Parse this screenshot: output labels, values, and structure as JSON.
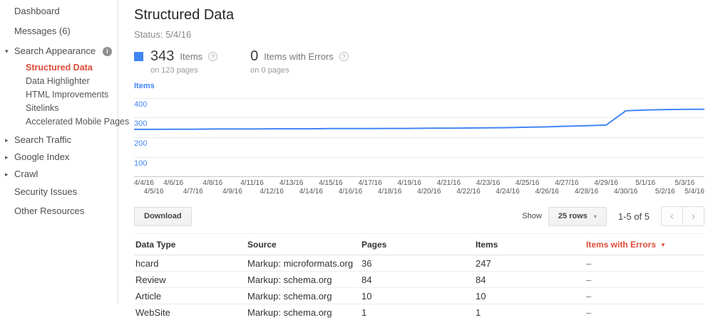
{
  "colors": {
    "accent_blue": "#4285f4",
    "alert_red": "#dd4b39"
  },
  "sidebar": {
    "items": [
      {
        "label": "Dashboard"
      },
      {
        "label": "Messages (6)"
      },
      {
        "label": "Search Appearance",
        "expanded": true,
        "has_info_icon": true
      },
      {
        "label": "Structured Data",
        "selected": true
      },
      {
        "label": "Data Highlighter"
      },
      {
        "label": "HTML Improvements"
      },
      {
        "label": "Sitelinks"
      },
      {
        "label": "Accelerated Mobile Pages"
      },
      {
        "label": "Search Traffic",
        "collapsed": true
      },
      {
        "label": "Google Index",
        "collapsed": true
      },
      {
        "label": "Crawl",
        "collapsed": true
      },
      {
        "label": "Security Issues"
      },
      {
        "label": "Other Resources"
      }
    ]
  },
  "header": {
    "title": "Structured Data",
    "status": "Status: 5/4/16"
  },
  "summary": {
    "items": {
      "count": "343",
      "label": "Items",
      "sub": "on 123 pages"
    },
    "errors": {
      "count": "0",
      "label": "Items with Errors",
      "sub": "on 0 pages"
    }
  },
  "chart_data": {
    "type": "line",
    "title": "Items",
    "ylabel": "Items",
    "xlabel": "",
    "grid": "horizontal",
    "legend_position": "none",
    "line_color": "#4285f4",
    "ylim": [
      0,
      425
    ],
    "yticks": [
      100,
      200,
      300,
      400
    ],
    "x": [
      "4/4/16",
      "4/5/16",
      "4/6/16",
      "4/7/16",
      "4/8/16",
      "4/9/16",
      "4/11/16",
      "4/12/16",
      "4/13/16",
      "4/14/16",
      "4/15/16",
      "4/16/16",
      "4/17/16",
      "4/18/16",
      "4/19/16",
      "4/20/16",
      "4/21/16",
      "4/22/16",
      "4/23/16",
      "4/24/16",
      "4/25/16",
      "4/26/16",
      "4/27/16",
      "4/28/16",
      "4/29/16",
      "4/30/16",
      "5/1/16",
      "5/2/16",
      "5/3/16",
      "5/4/16"
    ],
    "series": [
      {
        "name": "Items",
        "values": [
          240,
          240,
          241,
          241,
          242,
          242,
          242,
          243,
          243,
          243,
          244,
          244,
          244,
          245,
          245,
          246,
          246,
          247,
          248,
          249,
          251,
          253,
          256,
          259,
          262,
          335,
          339,
          341,
          342,
          343
        ]
      }
    ]
  },
  "toolbar": {
    "download": "Download",
    "show": "Show",
    "rows_per_page": "25 rows",
    "range": "1-5 of 5"
  },
  "table": {
    "headers": [
      "Data Type",
      "Source",
      "Pages",
      "Items",
      "Items with Errors"
    ],
    "rows": [
      {
        "data_type": "hcard",
        "source": "Markup: microformats.org",
        "pages": "36",
        "items": "247",
        "items_with_errors": "–"
      },
      {
        "data_type": "Review",
        "source": "Markup: schema.org",
        "pages": "84",
        "items": "84",
        "items_with_errors": "–"
      },
      {
        "data_type": "Article",
        "source": "Markup: schema.org",
        "pages": "10",
        "items": "10",
        "items_with_errors": "–"
      },
      {
        "data_type": "WebSite",
        "source": "Markup: schema.org",
        "pages": "1",
        "items": "1",
        "items_with_errors": "–"
      }
    ]
  }
}
